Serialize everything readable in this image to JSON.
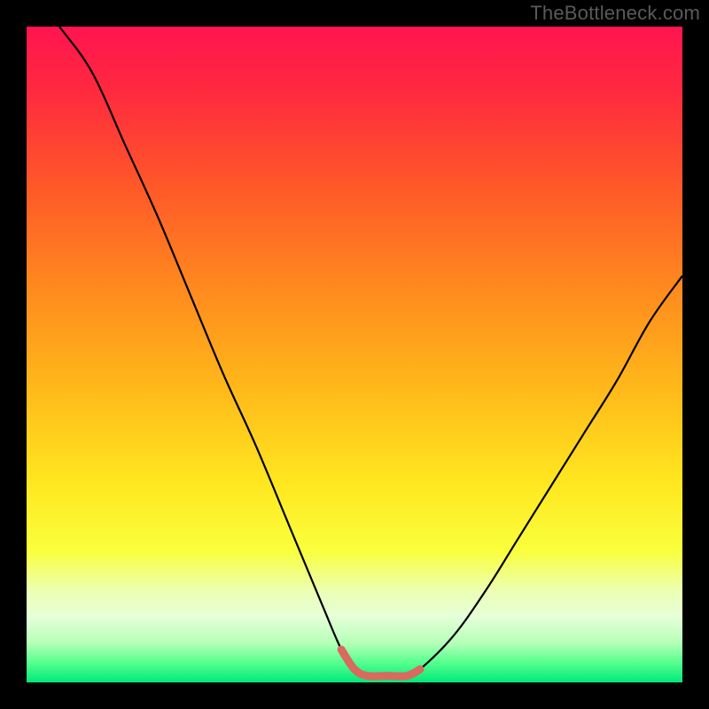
{
  "watermark": "TheBottleneck.com",
  "gradient": {
    "stops": [
      {
        "offset": "0%",
        "color": "#ff1450"
      },
      {
        "offset": "10%",
        "color": "#ff2a3e"
      },
      {
        "offset": "25%",
        "color": "#ff5a28"
      },
      {
        "offset": "40%",
        "color": "#ff8a1e"
      },
      {
        "offset": "55%",
        "color": "#ffb81a"
      },
      {
        "offset": "70%",
        "color": "#ffe820"
      },
      {
        "offset": "80%",
        "color": "#f9ff3d"
      },
      {
        "offset": "86%",
        "color": "#ecffb3"
      },
      {
        "offset": "90%",
        "color": "#e5ffd8"
      },
      {
        "offset": "94%",
        "color": "#b5ffb8"
      },
      {
        "offset": "97%",
        "color": "#55ff8e"
      },
      {
        "offset": "100%",
        "color": "#00e87a"
      }
    ]
  },
  "colors": {
    "curve": "#000000",
    "trough_highlight": "#d86a5f"
  },
  "chart_data": {
    "type": "line",
    "title": "",
    "xlabel": "",
    "ylabel": "",
    "xlim": [
      0,
      100
    ],
    "ylim": [
      0,
      100
    ],
    "series": [
      {
        "name": "bottleneck-curve",
        "x": [
          5,
          10,
          15,
          20,
          25,
          30,
          35,
          40,
          45,
          48,
          50,
          52,
          55,
          58,
          60,
          65,
          70,
          75,
          80,
          85,
          90,
          95,
          100
        ],
        "y": [
          100,
          93,
          82,
          71,
          59,
          47,
          36,
          24,
          12,
          5,
          2,
          1,
          1,
          1,
          2,
          7,
          14,
          22,
          30,
          38,
          46,
          55,
          62
        ]
      },
      {
        "name": "trough-highlight",
        "x": [
          48,
          50,
          52,
          55,
          58,
          60
        ],
        "y": [
          5,
          2,
          1,
          1,
          1,
          2
        ]
      }
    ]
  }
}
